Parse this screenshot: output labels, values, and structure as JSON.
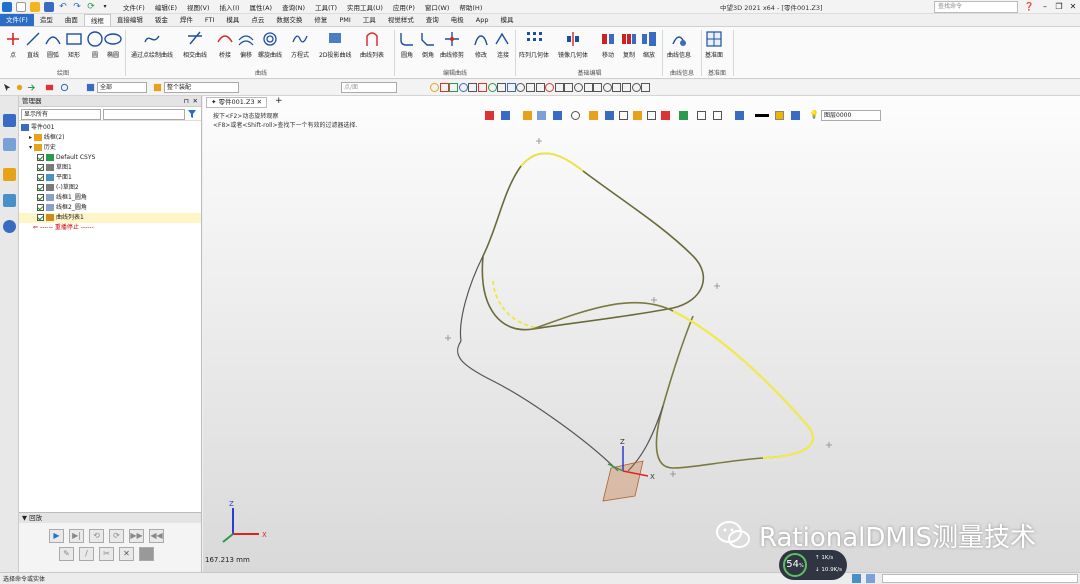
{
  "titlebar": {
    "menus": [
      "文件(F)",
      "编辑(E)",
      "视图(V)",
      "插入(I)",
      "属性(A)",
      "查询(N)",
      "工具(T)",
      "实用工具(U)",
      "应用(P)",
      "窗口(W)",
      "帮助(H)"
    ],
    "window_title": "中望3D 2021 x64 - [零件001.Z3]",
    "search_placeholder": "查找命令"
  },
  "tabs": [
    "文件(F)",
    "造型",
    "曲面",
    "线框",
    "直接编辑",
    "钣金",
    "焊件",
    "FTI",
    "模具",
    "点云",
    "数据交换",
    "修复",
    "PMI",
    "工具",
    "视觉样式",
    "查询",
    "电极",
    "App",
    "模具"
  ],
  "active_tab_index": 3,
  "ribbon": {
    "groups": [
      {
        "label": "绘图",
        "buttons": [
          "点",
          "直线",
          "圆弧",
          "矩形",
          "圆",
          "椭圆"
        ]
      },
      {
        "label": "曲线",
        "buttons": [
          "通过点绘制曲线",
          "相交曲线",
          "桥接",
          "偏移",
          "螺旋曲线",
          "方程式",
          "2D投影曲线",
          "曲线列表"
        ]
      },
      {
        "label": "编辑曲线",
        "buttons": [
          "圆角",
          "倒角",
          "曲线修剪",
          "修改",
          "连接"
        ]
      },
      {
        "label": "基础编辑",
        "buttons": [
          "阵列几何体",
          "镜像几何体",
          "移动",
          "复制",
          "缩放"
        ]
      },
      {
        "label": "曲线信息",
        "buttons": [
          "曲线信息"
        ]
      },
      {
        "label": "基准面",
        "buttons": [
          "基准面"
        ]
      }
    ]
  },
  "toolbar2": {
    "filter_value": "全部",
    "scope_value": "整个装配",
    "pick_mode": "点/面"
  },
  "manager": {
    "title": "管理器",
    "display_combo": "显示所有",
    "tree": [
      {
        "label": "零件001",
        "level": 0,
        "icon": "part-icon"
      },
      {
        "label": "线框(2)",
        "level": 1,
        "icon": "folder-icon"
      },
      {
        "label": "历史",
        "level": 1,
        "icon": "folder-icon"
      },
      {
        "label": "Default CSYS",
        "level": 2,
        "icon": "csys-icon",
        "checked": true
      },
      {
        "label": "草图1",
        "level": 2,
        "icon": "sketch-icon",
        "checked": true
      },
      {
        "label": "平面1",
        "level": 2,
        "icon": "plane-icon",
        "checked": true
      },
      {
        "label": "(-)草图2",
        "level": 2,
        "icon": "sketch-icon",
        "checked": true
      },
      {
        "label": "线框1_圆角",
        "level": 2,
        "icon": "wire-icon",
        "checked": true
      },
      {
        "label": "线框2_圆角",
        "level": 2,
        "icon": "wire-icon",
        "checked": true
      },
      {
        "label": "曲线列表1",
        "level": 2,
        "icon": "curve-list-icon",
        "checked": true,
        "highlight": true
      }
    ],
    "stop_label": "------ 重播停止 ------",
    "playback_title": "回放"
  },
  "viewport": {
    "doc_tab": "零件001.Z3",
    "hint1": "按下<F2>动态旋转观察",
    "hint2": "<F8>或者<Shift-roll>查找下一个有效的过滤器选择.",
    "layer_combo": "图层0000",
    "measure": "167.213 mm",
    "axis_z": "Z",
    "axis_x": "X"
  },
  "status": {
    "text": "选择命令或实体"
  },
  "watermark": {
    "text": "RationalDMIS测量技术"
  },
  "perf": {
    "percent": "54",
    "unit": "%",
    "up": "1K/s",
    "down": "10.9K/s"
  }
}
